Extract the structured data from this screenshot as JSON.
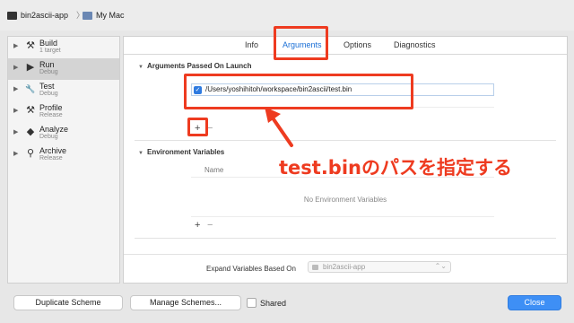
{
  "scheme_bar": {
    "scheme_name": "bin2ascii-app",
    "separator": "〉",
    "destination": "My Mac"
  },
  "sidebar": {
    "items": [
      {
        "name": "Build",
        "sub": "1 target",
        "icon": "hammer-icon",
        "glyph": "⚒",
        "active": false
      },
      {
        "name": "Run",
        "sub": "Debug",
        "icon": "play-icon",
        "glyph": "▶",
        "active": true
      },
      {
        "name": "Test",
        "sub": "Debug",
        "icon": "wrench-icon",
        "glyph": "🔧",
        "active": false
      },
      {
        "name": "Profile",
        "sub": "Release",
        "icon": "tools-icon",
        "glyph": "⚒",
        "active": false
      },
      {
        "name": "Analyze",
        "sub": "Debug",
        "icon": "analyze-icon",
        "glyph": "◆",
        "active": false
      },
      {
        "name": "Archive",
        "sub": "Release",
        "icon": "archive-icon",
        "glyph": "⚲",
        "active": false
      }
    ]
  },
  "tabs": {
    "info": "Info",
    "arguments": "Arguments",
    "options": "Options",
    "diagnostics": "Diagnostics"
  },
  "arguments": {
    "section_title": "Arguments Passed On Launch",
    "value": "/Users/yoshihitoh/workspace/bin2ascii/test.bin",
    "checked": true,
    "add": "+",
    "remove": "−"
  },
  "environment": {
    "section_title": "Environment Variables",
    "column_name": "Name",
    "empty_text": "No Environment Variables",
    "add": "+",
    "remove": "−"
  },
  "expand": {
    "label": "Expand Variables Based On",
    "value": "bin2ascii-app",
    "chevron": "⌃⌄"
  },
  "buttons": {
    "duplicate": "Duplicate Scheme",
    "manage": "Manage Schemes...",
    "shared": "Shared",
    "close": "Close"
  },
  "annotation": {
    "text": "test.binのパスを指定する",
    "color": "#ee3b20"
  },
  "colors": {
    "selected_tab": "#1a6fd6",
    "primary_button": "#3e8ff5",
    "checkbox": "#2f7be0"
  }
}
